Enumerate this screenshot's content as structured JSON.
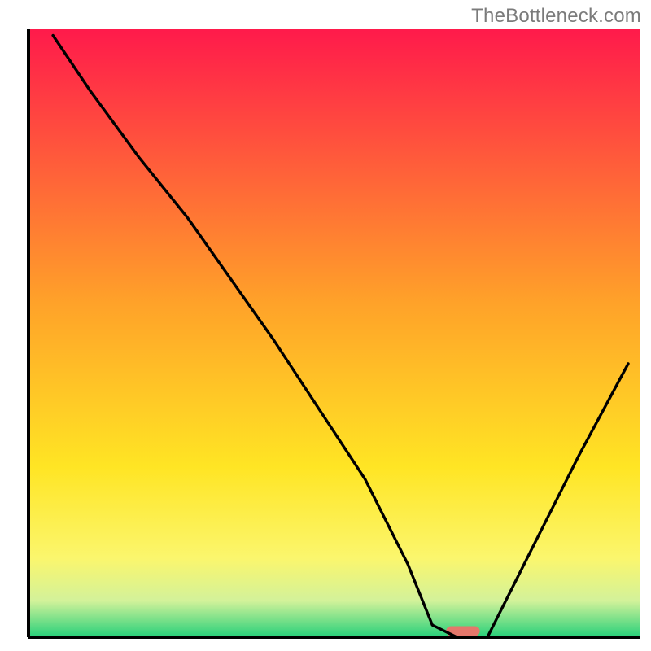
{
  "watermark": "TheBottleneck.com",
  "chart_data": {
    "type": "line",
    "title": "",
    "xlabel": "",
    "ylabel": "",
    "xlim": [
      0,
      100
    ],
    "ylim": [
      0,
      100
    ],
    "grid": false,
    "legend": false,
    "background_gradient_stops": [
      {
        "pct": 0.0,
        "color": "#ff1a4b"
      },
      {
        "pct": 0.45,
        "color": "#ffa229"
      },
      {
        "pct": 0.72,
        "color": "#ffe524"
      },
      {
        "pct": 0.87,
        "color": "#fbf66d"
      },
      {
        "pct": 0.94,
        "color": "#d3f29a"
      },
      {
        "pct": 1.0,
        "color": "#27d07a"
      }
    ],
    "series": [
      {
        "name": "bottleneck-curve",
        "color": "#000000",
        "x": [
          4,
          10,
          18,
          26,
          40,
          55,
          62,
          66,
          70,
          75,
          82,
          90,
          98
        ],
        "values": [
          99,
          90,
          79,
          69,
          49,
          26,
          12,
          2,
          0,
          0,
          14,
          30,
          45
        ]
      }
    ],
    "marker": {
      "name": "optimal-zone",
      "x": 71,
      "y": 1,
      "color": "#e4776b",
      "width_pct": 5.5,
      "height_pct": 1.6
    }
  }
}
